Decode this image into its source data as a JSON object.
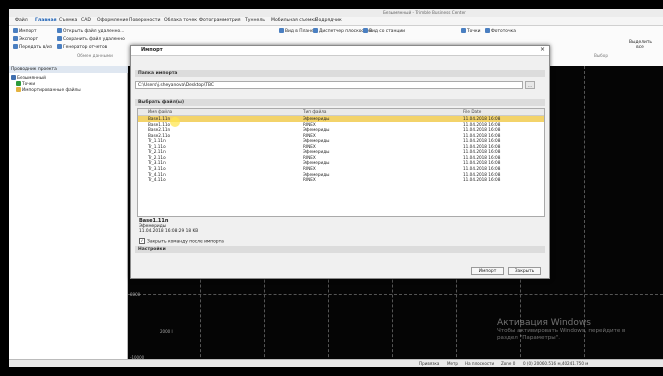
{
  "window": {
    "title": "Безымянный - Trimble Business Center"
  },
  "menu": [
    "Файл",
    "Главная",
    "Съемка",
    "CAD",
    "Оформление",
    "Поверхности",
    "Облака точек",
    "Фотограмметрия",
    "Туннель",
    "Мобильная съемка",
    "Подрядчик"
  ],
  "ribbon": {
    "left_items": [
      "Импорт",
      "Экспорт",
      "Передать в/из"
    ],
    "mid_items": [
      "Открыть файл удаленно...",
      "Сохранить файл удаленно",
      "Генератор отчетов"
    ],
    "group_label": "Обмен данными",
    "toolbar_items": [
      "Вид в Плане",
      "Диспетчер плоскостей",
      "Вид со станции"
    ],
    "right_items": [
      "Точки",
      "Фототочка"
    ],
    "select_label": "Выделить все",
    "select_group": "Выбор"
  },
  "panel": {
    "title": "Проводник проекта",
    "tree": [
      "Безымянный",
      "Точки",
      "Импортированные файлы"
    ]
  },
  "dialog": {
    "title": "Импорт",
    "folder_section": "Папка импорта",
    "folder_path": "C:\\Users\\j.sheyanova\\Desktop\\TBC",
    "browse": "...",
    "files_section": "Выбрать файл(ы)",
    "columns": [
      "Имя файла",
      "Тип файла",
      "File Date"
    ],
    "files": [
      {
        "name": "Base1.11n",
        "type": "Эфемериды",
        "date": "11.04.2018 16:08"
      },
      {
        "name": "Base1.11o",
        "type": "RINEX",
        "date": "11.04.2018 16:08"
      },
      {
        "name": "Base2.11n",
        "type": "Эфемериды",
        "date": "11.04.2018 16:08"
      },
      {
        "name": "Base2.11o",
        "type": "RINEX",
        "date": "11.04.2018 16:08"
      },
      {
        "name": "Tr_1.11n",
        "type": "Эфемериды",
        "date": "11.04.2018 16:08"
      },
      {
        "name": "Tr_1.11o",
        "type": "RINEX",
        "date": "11.04.2018 16:08"
      },
      {
        "name": "Tr_2.11n",
        "type": "Эфемериды",
        "date": "11.04.2018 16:08"
      },
      {
        "name": "Tr_2.11o",
        "type": "RINEX",
        "date": "11.04.2018 16:08"
      },
      {
        "name": "Tr_3.11n",
        "type": "Эфемериды",
        "date": "11.04.2018 16:08"
      },
      {
        "name": "Tr_3.11o",
        "type": "RINEX",
        "date": "11.04.2018 16:08"
      },
      {
        "name": "Tr_4.11n",
        "type": "Эфемериды",
        "date": "11.04.2018 16:08"
      },
      {
        "name": "Tr_4.11o",
        "type": "RINEX",
        "date": "11.04.2018 16:08"
      }
    ],
    "selected_index": 0,
    "info_name": "Base1.11n",
    "info_type": "Эфемериды",
    "info_date": "11.04.2018 16:08:29  18 KB",
    "close_after": "Закрыть команду после импорта",
    "settings_section": "Настройки",
    "import_button": "Импорт",
    "close_button": "Закрыть"
  },
  "canvas": {
    "labels": [
      "8000",
      "2000 l",
      "-10000"
    ]
  },
  "status": {
    "left": "Привязка",
    "metric": "Метр",
    "plane": "На плоскости",
    "zone": "Zone 0",
    "coords": "0  (0) 20060.516 м,40241.750 м"
  },
  "watermark": {
    "line1": "Активация Windows",
    "line2": "Чтобы активировать Windows, перейдите в",
    "line3": "раздел \"Параметры\"."
  },
  "colors": {
    "selection": "#f3d36a",
    "accent": "#1a5fb4"
  }
}
